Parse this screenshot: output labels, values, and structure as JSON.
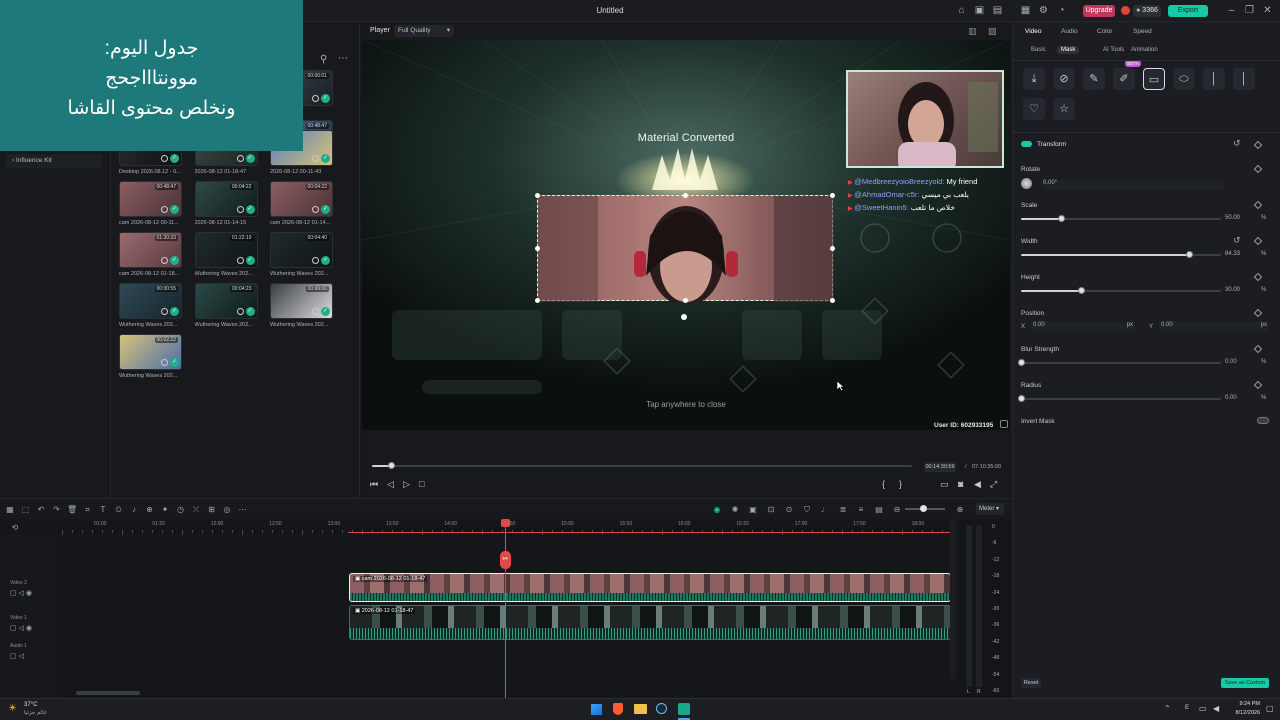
{
  "overlay_note": {
    "line1": "جدول اليوم:",
    "line2": "موونتاااجحج",
    "line3": "ونخلص محتوى القاشا"
  },
  "titlebar": {
    "title": "Untitled",
    "upgrade": "Upgrade",
    "credits": "3366",
    "export": "Export"
  },
  "left_panel": {
    "sidebar_items": [
      "Influence Kit"
    ],
    "clips": [
      {
        "name": "",
        "duration": "00:00:01"
      },
      {
        "name": "2026.08.12 - 0...",
        "duration": "00:48:47"
      },
      {
        "name": "Desktop 2026.08.12 - 0...",
        "duration": ""
      },
      {
        "name": "2026-08-12 01-18-47",
        "duration": ""
      },
      {
        "name": "2026-08-12 00-11-43",
        "duration": ""
      },
      {
        "name": "cam 2026-08-12 00-11...",
        "duration": "00:48:47"
      },
      {
        "name": "2026-08-12 01-14-15",
        "duration": "00:04:22"
      },
      {
        "name": "cam 2026-08-12 01-14...",
        "duration": "00:04:22"
      },
      {
        "name": "cam 2026-08-12 01-18...",
        "duration": "01:30:33"
      },
      {
        "name": "Wuthering Waves 202...",
        "duration": "01:22:10"
      },
      {
        "name": "Wuthering Waves 202...",
        "duration": "00:04:40"
      },
      {
        "name": "Wuthering Waves 202...",
        "duration": "00:00:55"
      },
      {
        "name": "Wuthering Waves 202...",
        "duration": "00:04:23"
      },
      {
        "name": "Wuthering Waves 202...",
        "duration": "00:99:00"
      },
      {
        "name": "Wuthering Waves 202...",
        "duration": "00:02:22"
      }
    ]
  },
  "player": {
    "label": "Player",
    "quality": "Full Quality",
    "material_converted": "Material Converted",
    "tap_close": "Tap anywhere to close",
    "user_id": "User ID: 602933195",
    "current_time": "00:14:30:59",
    "total_time": "07:10:35:00",
    "progress": 0.035
  },
  "chat": [
    {
      "user": "@MedbreezyoioBreezyold:",
      "msg": "My friend"
    },
    {
      "user": "@AhmadOmar-c5r:",
      "msg": "يلعب بي ميسي"
    },
    {
      "user": "@SweetHanin5:",
      "msg": "خلاص ما تلعب"
    }
  ],
  "right_panel": {
    "tabs": [
      "Video",
      "Audio",
      "Color",
      "Speed"
    ],
    "subtabs": [
      "Basic",
      "Mask",
      "AI Tools",
      "Animation"
    ],
    "beta_badge": "BETA",
    "transform": "Transform",
    "rotate_label": "Rotate",
    "rotate_value": "0.00°",
    "scale_label": "Scale",
    "scale_value": "50.00",
    "scale_pct": 0.2,
    "width_label": "Width",
    "width_value": "84.33",
    "width_pct": 0.84,
    "height_label": "Height",
    "height_value": "30.00",
    "height_pct": 0.3,
    "position_label": "Position",
    "pos_x_label": "X",
    "pos_x": "0.00",
    "pos_y_label": "Y",
    "pos_y": "0.00",
    "px": "px",
    "blur_label": "Blur Strength",
    "blur_value": "0.00",
    "radius_label": "Radius",
    "radius_value": "0.00",
    "percent": "%",
    "invert_mask": "Invert Mask",
    "reset": "Reset",
    "save_custom": "Save as Custom"
  },
  "timeline": {
    "meter": "Meter",
    "ruler": [
      "01:00",
      "01:50",
      "12:00",
      "12:50",
      "13:00",
      "13:50",
      "14:00",
      "14:50",
      "15:00",
      "15:50",
      "16:00",
      "16:50",
      "17:00",
      "17:50",
      "18:00"
    ],
    "tracks": [
      {
        "name": "Video 2",
        "clip": "cam 2026-08-12 01-18-47"
      },
      {
        "name": "Video 1",
        "clip": "2026-08-12 01-18-47"
      },
      {
        "name": "Audio 1",
        "clip": ""
      }
    ],
    "db_scale": [
      "0",
      "-6",
      "-12",
      "-18",
      "-24",
      "-30",
      "-36",
      "-42",
      "-48",
      "-54",
      "-60"
    ],
    "lr": [
      "L",
      "R"
    ]
  },
  "taskbar": {
    "weather_temp": "37°C",
    "weather_text": "غائم جزئيا",
    "lang": "E",
    "time": "9:24 PM",
    "date": "8/12/2026"
  }
}
